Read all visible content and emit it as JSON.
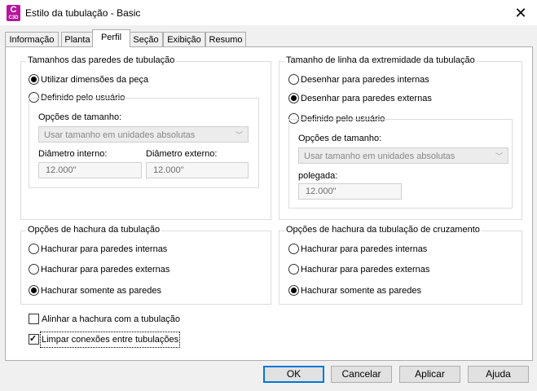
{
  "window": {
    "title": "Estilo da tubulação - Basic",
    "close": "✕",
    "app_icon_letter": "C",
    "app_icon_year": "C3D"
  },
  "tabs": [
    "Informação",
    "Planta",
    "Perfil",
    "Seção",
    "Exibição",
    "Resumo"
  ],
  "active_tab": "Perfil",
  "wall_sizes": {
    "title": "Tamanhos das paredes de tubulação",
    "opt_part": "Utilizar dimensões da peça",
    "opt_user": "Definido pelo usuário",
    "size_options_label": "Opções de tamanho:",
    "size_options_value": "Usar tamanho em unidades absolutas",
    "inner_label": "Diâmetro interno:",
    "inner_value": "12.000\"",
    "outer_label": "Diâmetro externo:",
    "outer_value": "12.000\""
  },
  "end_line": {
    "title": "Tamanho de linha da extremidade da tubulação",
    "opt_inner": "Desenhar para paredes internas",
    "opt_outer": "Desenhar para paredes externas",
    "opt_user": "Definido pelo usuário",
    "size_options_label": "Opções de tamanho:",
    "size_options_value": "Usar tamanho em unidades absolutas",
    "unit_label": "polegada:",
    "unit_value": "12.000\""
  },
  "hatch": {
    "title": "Opções de hachura da tubulação",
    "opt_inner": "Hachurar para paredes internas",
    "opt_outer": "Hachurar para paredes externas",
    "opt_walls": "Hachurar somente as paredes"
  },
  "cross_hatch": {
    "title": "Opções de hachura da tubulação de cruzamento",
    "opt_inner": "Hachurar para paredes internas",
    "opt_outer": "Hachurar para paredes externas",
    "opt_walls": "Hachurar somente as paredes"
  },
  "checks": {
    "align": "Alinhar a hachura com a tubulação",
    "clean": "Limpar conexões entre tubulações"
  },
  "buttons": {
    "ok": "OK",
    "cancel": "Cancelar",
    "apply": "Aplicar",
    "help": "Ajuda"
  }
}
